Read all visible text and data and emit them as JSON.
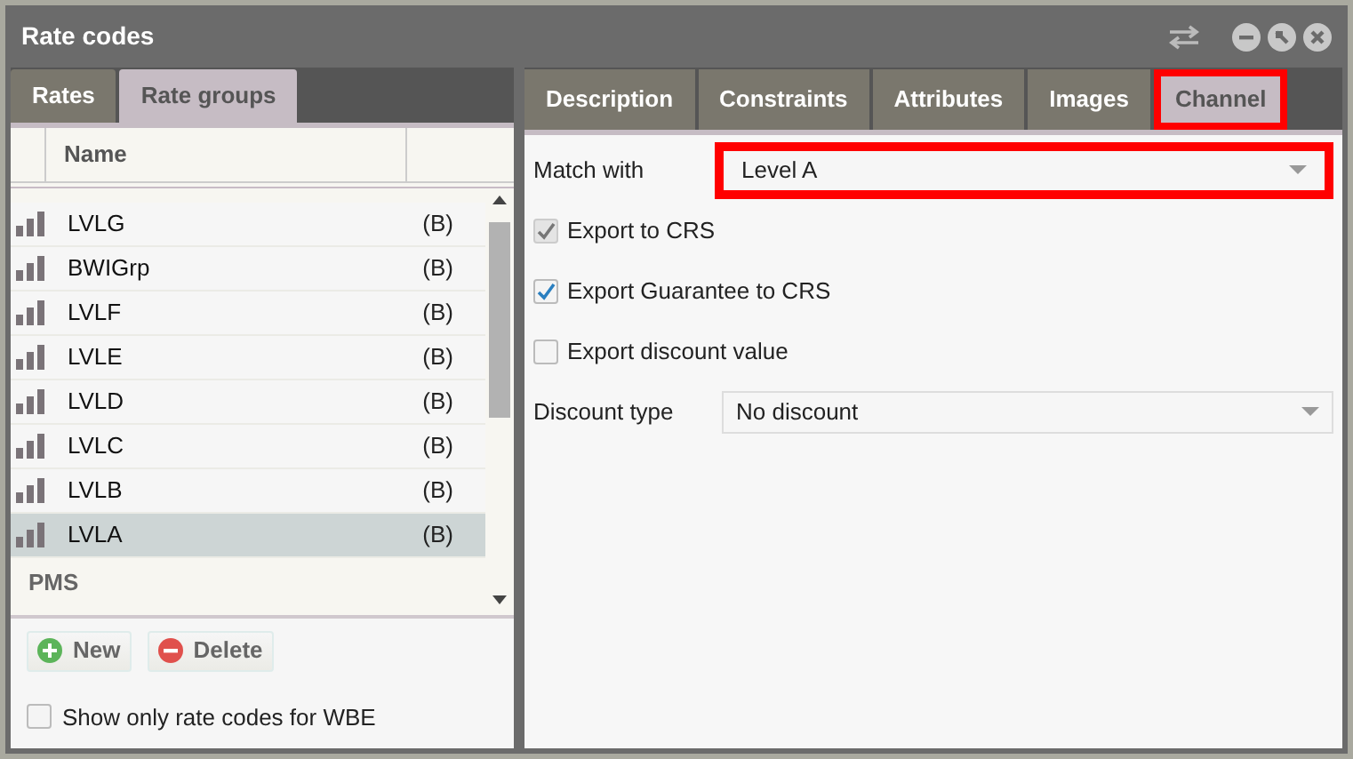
{
  "window": {
    "title": "Rate codes"
  },
  "left_tabs": [
    {
      "label": "Rates",
      "selected": false
    },
    {
      "label": "Rate groups",
      "selected": true
    }
  ],
  "list": {
    "columns": [
      "Name"
    ],
    "rows": [
      {
        "name": "LVLG",
        "suffix": "(B)",
        "selected": false
      },
      {
        "name": "BWIGrp",
        "suffix": "(B)",
        "selected": false
      },
      {
        "name": "LVLF",
        "suffix": "(B)",
        "selected": false
      },
      {
        "name": "LVLE",
        "suffix": "(B)",
        "selected": false
      },
      {
        "name": "LVLD",
        "suffix": "(B)",
        "selected": false
      },
      {
        "name": "LVLC",
        "suffix": "(B)",
        "selected": false
      },
      {
        "name": "LVLB",
        "suffix": "(B)",
        "selected": false
      },
      {
        "name": "LVLA",
        "suffix": "(B)",
        "selected": true
      }
    ],
    "group": "PMS"
  },
  "buttons": [
    {
      "label": "New",
      "kind": "add"
    },
    {
      "label": "Delete",
      "kind": "delete"
    }
  ],
  "wbe_filter": {
    "label": "Show only rate codes for WBE",
    "checked": false
  },
  "right_tabs": [
    {
      "label": "Description",
      "selected": false,
      "highlighted": false
    },
    {
      "label": "Constraints",
      "selected": false,
      "highlighted": false
    },
    {
      "label": "Attributes",
      "selected": false,
      "highlighted": false
    },
    {
      "label": "Images",
      "selected": false,
      "highlighted": false
    },
    {
      "label": "Channel",
      "selected": true,
      "highlighted": true
    }
  ],
  "form": [
    {
      "kind": "select",
      "label": "Match with",
      "value": "Level A",
      "highlighted": true
    },
    {
      "kind": "checkbox",
      "label": "Export to CRS",
      "checked": true,
      "disabled": true
    },
    {
      "kind": "checkbox",
      "label": "Export Guarantee to CRS",
      "checked": true,
      "disabled": false
    },
    {
      "kind": "checkbox",
      "label": "Export discount value",
      "checked": false,
      "disabled": false
    },
    {
      "kind": "select",
      "label": "Discount type",
      "value": "No discount",
      "highlighted": false
    }
  ]
}
